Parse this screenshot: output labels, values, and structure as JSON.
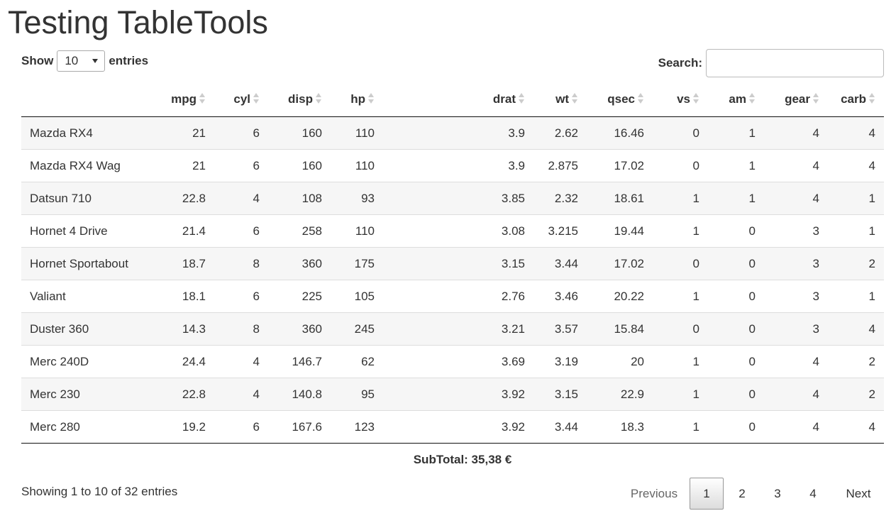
{
  "page": {
    "title": "Testing TableTools"
  },
  "length": {
    "label_before": "Show",
    "selected": "10",
    "label_after": "entries"
  },
  "search": {
    "label": "Search:",
    "value": "",
    "placeholder": ""
  },
  "table": {
    "columns": [
      "",
      "mpg",
      "cyl",
      "disp",
      "hp",
      "drat",
      "wt",
      "qsec",
      "vs",
      "am",
      "gear",
      "carb"
    ],
    "rows": [
      [
        "Mazda RX4",
        "21",
        "6",
        "160",
        "110",
        "3.9",
        "2.62",
        "16.46",
        "0",
        "1",
        "4",
        "4"
      ],
      [
        "Mazda RX4 Wag",
        "21",
        "6",
        "160",
        "110",
        "3.9",
        "2.875",
        "17.02",
        "0",
        "1",
        "4",
        "4"
      ],
      [
        "Datsun 710",
        "22.8",
        "4",
        "108",
        "93",
        "3.85",
        "2.32",
        "18.61",
        "1",
        "1",
        "4",
        "1"
      ],
      [
        "Hornet 4 Drive",
        "21.4",
        "6",
        "258",
        "110",
        "3.08",
        "3.215",
        "19.44",
        "1",
        "0",
        "3",
        "1"
      ],
      [
        "Hornet Sportabout",
        "18.7",
        "8",
        "360",
        "175",
        "3.15",
        "3.44",
        "17.02",
        "0",
        "0",
        "3",
        "2"
      ],
      [
        "Valiant",
        "18.1",
        "6",
        "225",
        "105",
        "2.76",
        "3.46",
        "20.22",
        "1",
        "0",
        "3",
        "1"
      ],
      [
        "Duster 360",
        "14.3",
        "8",
        "360",
        "245",
        "3.21",
        "3.57",
        "15.84",
        "0",
        "0",
        "3",
        "4"
      ],
      [
        "Merc 240D",
        "24.4",
        "4",
        "146.7",
        "62",
        "3.69",
        "3.19",
        "20",
        "1",
        "0",
        "4",
        "2"
      ],
      [
        "Merc 230",
        "22.8",
        "4",
        "140.8",
        "95",
        "3.92",
        "3.15",
        "22.9",
        "1",
        "0",
        "4",
        "2"
      ],
      [
        "Merc 280",
        "19.2",
        "6",
        "167.6",
        "123",
        "3.92",
        "3.44",
        "18.3",
        "1",
        "0",
        "4",
        "4"
      ]
    ]
  },
  "footer": {
    "subtotal": "SubTotal: 35,38 €",
    "info": "Showing 1 to 10 of 32 entries"
  },
  "pagination": {
    "previous": "Previous",
    "pages": [
      "1",
      "2",
      "3",
      "4"
    ],
    "current": "1",
    "next": "Next"
  }
}
